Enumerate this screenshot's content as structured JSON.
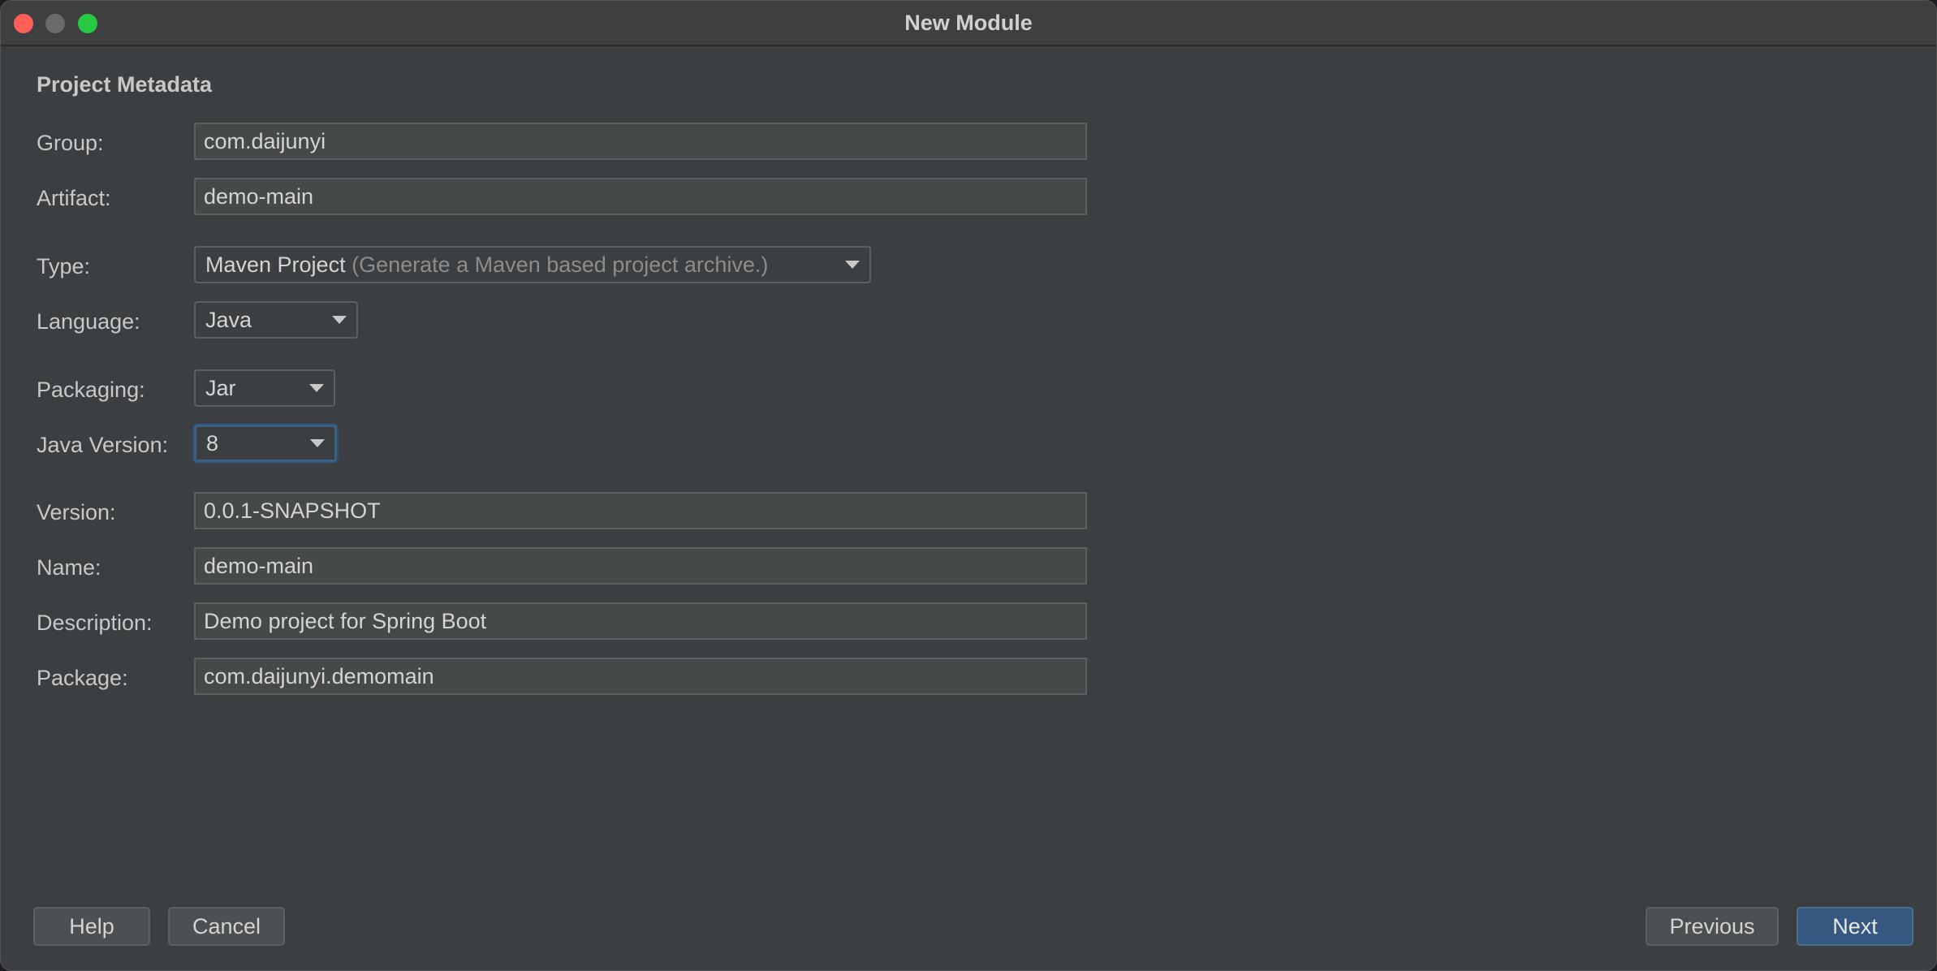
{
  "window": {
    "title": "New Module"
  },
  "section": {
    "title": "Project Metadata"
  },
  "form": {
    "group": {
      "label": "Group:",
      "value": "com.daijunyi"
    },
    "artifact": {
      "label": "Artifact:",
      "value": "demo-main"
    },
    "type": {
      "label": "Type:",
      "value": "Maven Project",
      "hint": "(Generate a Maven based project archive.)"
    },
    "language": {
      "label": "Language:",
      "value": "Java"
    },
    "packaging": {
      "label": "Packaging:",
      "value": "Jar"
    },
    "java_version": {
      "label": "Java Version:",
      "value": "8"
    },
    "version": {
      "label": "Version:",
      "value": "0.0.1-SNAPSHOT"
    },
    "name": {
      "label": "Name:",
      "value": "demo-main"
    },
    "description": {
      "label": "Description:",
      "value": "Demo project for Spring Boot"
    },
    "package": {
      "label": "Package:",
      "value": "com.daijunyi.demomain"
    }
  },
  "buttons": {
    "help": "Help",
    "cancel": "Cancel",
    "previous": "Previous",
    "next": "Next"
  },
  "colors": {
    "background": "#3c3f41",
    "primary_button": "#365880",
    "focus_ring": "#3d6185"
  }
}
